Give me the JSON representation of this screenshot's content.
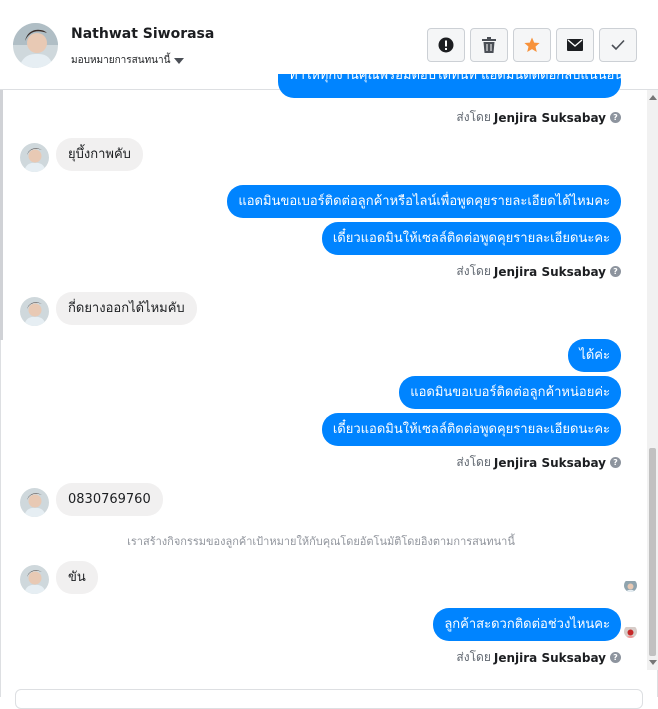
{
  "header": {
    "contact_name": "Nathwat Siworasa",
    "assign_label": "มอบหมายการสนทนานี้",
    "actions": [
      {
        "name": "report-button",
        "icon": "alert-icon"
      },
      {
        "name": "delete-button",
        "icon": "trash-icon"
      },
      {
        "name": "star-button",
        "icon": "star-icon"
      },
      {
        "name": "mail-button",
        "icon": "envelope-icon"
      },
      {
        "name": "done-button",
        "icon": "check-icon"
      }
    ]
  },
  "colors": {
    "outgoing_bubble": "#0084ff",
    "incoming_bubble": "#f1f0f0",
    "star": "#f7923b"
  },
  "messages": {
    "m0": "ทำให้ทุกงานคุณพร้อมตอบได้ทันที แอดมินติดต่อกลับแน่นอน",
    "sent0": "ส่งโดย",
    "sent0_name": "Jenjira Suksabay",
    "m1": "ยุบึ้งกาพคับ",
    "m2": "แอดมินขอเบอร์ติดต่อลูกค้าหรือไลน์เพื่อพูดคุยรายละเอียดได้ไหมคะ",
    "m3": "เดี๋ยวแอดมินให้เซลล์ติดต่อพูดคุยรายละเอียดนะคะ",
    "sent1": "ส่งโดย",
    "sent1_name": "Jenjira Suksabay",
    "m4": "กี่ดยางออกได้ไหมคับ",
    "m5": "ได้ค่ะ",
    "m6": "แอดมินขอเบอร์ติดต่อลูกค้าหน่อยค่ะ",
    "m7": "เดี๋ยวแอดมินให้เซลล์ติดต่อพูดคุยรายละเอียดนะคะ",
    "sent2": "ส่งโดย",
    "sent2_name": "Jenjira Suksabay",
    "m8": "0830769760",
    "system_note": "เราสร้างกิจกรรมของลูกค้าเป้าหมายให้กับคุณโดยอัตโนมัติโดยอิงตามการสนทนานี้",
    "m9": "ขัน",
    "m10": "ลูกค้าสะดวกติดต่อช่วงไหนคะ",
    "sent3": "ส่งโดย",
    "sent3_name": "Jenjira Suksabay"
  }
}
